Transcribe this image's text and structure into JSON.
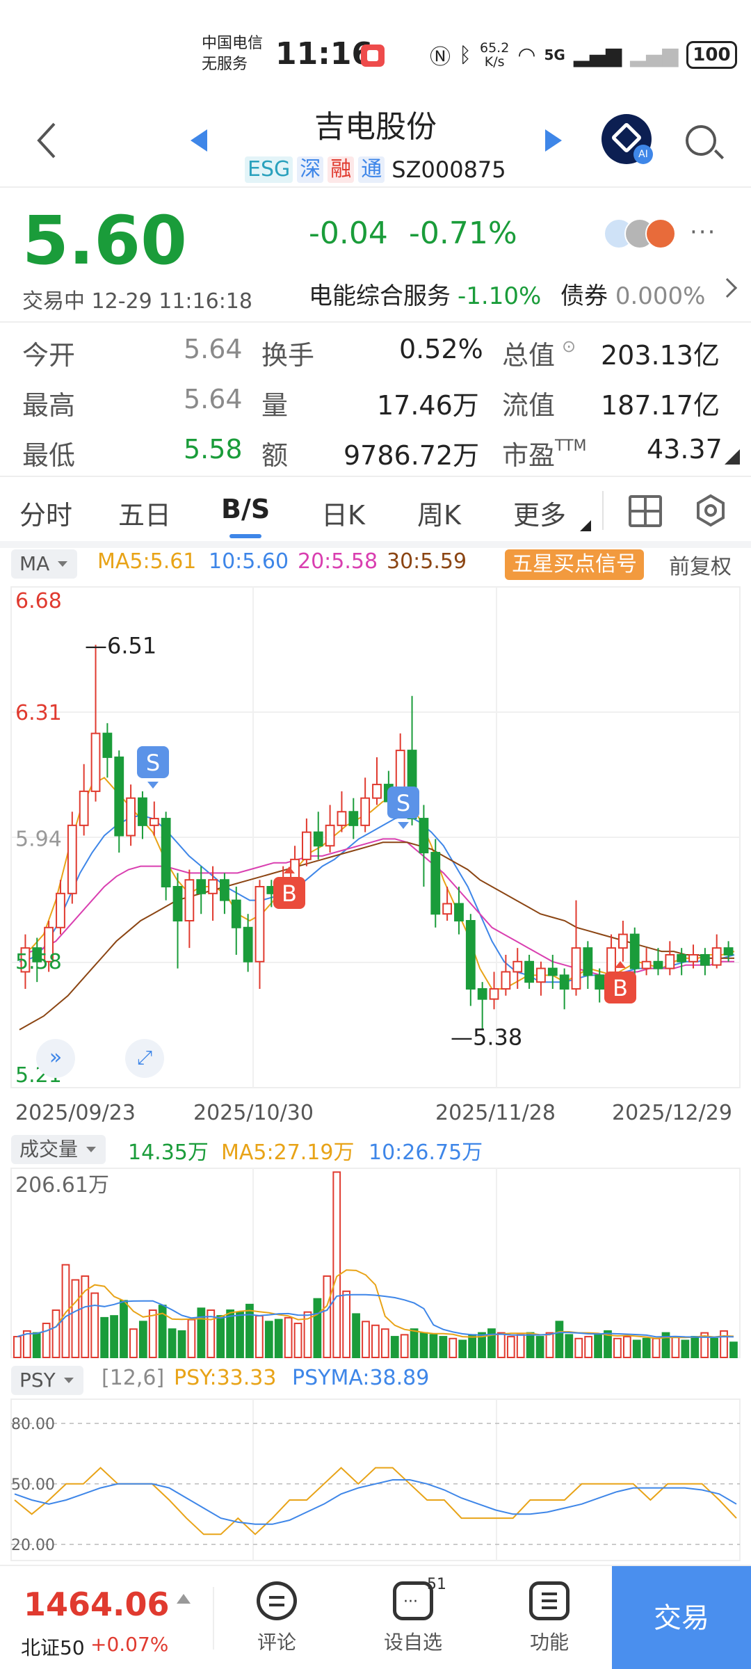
{
  "status_bar": {
    "carrier_line1": "中国电信",
    "carrier_line2": "无服务",
    "time": "11:16",
    "speed_value": "65.2",
    "speed_unit": "K/s",
    "network": "5G",
    "battery": "100"
  },
  "header": {
    "title": "吉电股份",
    "tags": [
      "ESG",
      "深",
      "融",
      "通"
    ],
    "code": "SZ000875",
    "ai_badge": "AI"
  },
  "quote": {
    "price": "5.60",
    "change": "-0.04",
    "change_pct": "-0.71%",
    "trade_time": "交易中 12-29 11:16:18",
    "sector_name": "电能综合服务",
    "sector_change": "-1.10%",
    "bond_label": "债券",
    "bond_value": "0.000%",
    "more": "···"
  },
  "stats": [
    [
      {
        "label": "今开",
        "value": "5.64"
      },
      {
        "label": "换手",
        "value": "0.52%"
      },
      {
        "label": "总值",
        "value": "203.13亿"
      }
    ],
    [
      {
        "label": "最高",
        "value": "5.64"
      },
      {
        "label": "量",
        "value": "17.46万"
      },
      {
        "label": "流值",
        "value": "187.17亿"
      }
    ],
    [
      {
        "label": "最低",
        "value": "5.58"
      },
      {
        "label": "额",
        "value": "9786.72万"
      },
      {
        "label": "市盈",
        "label_sup": "TTM",
        "value": "43.37"
      }
    ]
  ],
  "tabs": [
    "分时",
    "五日",
    "B/S",
    "日K",
    "周K",
    "更多"
  ],
  "active_tab": "B/S",
  "ma_bar": {
    "selector": "MA",
    "ma5": "MA5:5.61",
    "ma10": "10:5.60",
    "ma20": "20:5.58",
    "ma30": "30:5.59",
    "signal": "五星买点信号",
    "adjust": "前复权"
  },
  "colors": {
    "up": "#e03a2f",
    "down": "#1a9c3a",
    "ma5": "#e8a317",
    "ma10": "#3e86e8",
    "ma20": "#d93fb0",
    "ma30": "#8b4513",
    "accent": "#3e86e8"
  },
  "chart_data": [
    {
      "type": "candlestick",
      "price_axis_labels": [
        "6.68",
        "6.31",
        "5.94",
        "5.58",
        "5.21"
      ],
      "ylim": [
        5.21,
        6.68
      ],
      "x_tick_labels": [
        "2025/09/23",
        "2025/10/30",
        "2025/11/28",
        "2025/12/29"
      ],
      "annotations": {
        "high": "6.51",
        "low": "5.38",
        "sell_marker": "S",
        "buy_marker": "B"
      },
      "candles": [
        {
          "o": 5.55,
          "c": 5.62,
          "h": 5.66,
          "l": 5.5
        },
        {
          "o": 5.62,
          "c": 5.58,
          "h": 5.65,
          "l": 5.52
        },
        {
          "o": 5.58,
          "c": 5.68,
          "h": 5.7,
          "l": 5.55
        },
        {
          "o": 5.68,
          "c": 5.78,
          "h": 5.82,
          "l": 5.66
        },
        {
          "o": 5.78,
          "c": 5.98,
          "h": 6.02,
          "l": 5.75
        },
        {
          "o": 5.98,
          "c": 6.08,
          "h": 6.16,
          "l": 5.95
        },
        {
          "o": 6.08,
          "c": 6.25,
          "h": 6.51,
          "l": 6.05
        },
        {
          "o": 6.25,
          "c": 6.18,
          "h": 6.28,
          "l": 6.12
        },
        {
          "o": 6.18,
          "c": 5.95,
          "h": 6.2,
          "l": 5.9
        },
        {
          "o": 5.95,
          "c": 6.06,
          "h": 6.1,
          "l": 5.92
        },
        {
          "o": 6.06,
          "c": 5.98,
          "h": 6.08,
          "l": 5.94
        },
        {
          "o": 5.98,
          "c": 6.0,
          "h": 6.05,
          "l": 5.95
        },
        {
          "o": 6.0,
          "c": 5.8,
          "h": 6.02,
          "l": 5.76
        },
        {
          "o": 5.8,
          "c": 5.7,
          "h": 5.84,
          "l": 5.56
        },
        {
          "o": 5.7,
          "c": 5.82,
          "h": 5.85,
          "l": 5.62
        },
        {
          "o": 5.82,
          "c": 5.78,
          "h": 5.86,
          "l": 5.72
        },
        {
          "o": 5.78,
          "c": 5.82,
          "h": 5.86,
          "l": 5.7
        },
        {
          "o": 5.82,
          "c": 5.76,
          "h": 5.84,
          "l": 5.72
        },
        {
          "o": 5.76,
          "c": 5.68,
          "h": 5.8,
          "l": 5.6
        },
        {
          "o": 5.68,
          "c": 5.58,
          "h": 5.72,
          "l": 5.55
        },
        {
          "o": 5.58,
          "c": 5.8,
          "h": 5.82,
          "l": 5.5
        },
        {
          "o": 5.8,
          "c": 5.78,
          "h": 5.82,
          "l": 5.74
        },
        {
          "o": 5.78,
          "c": 5.82,
          "h": 5.86,
          "l": 5.76
        },
        {
          "o": 5.82,
          "c": 5.88,
          "h": 5.92,
          "l": 5.8
        },
        {
          "o": 5.88,
          "c": 5.96,
          "h": 6.0,
          "l": 5.86
        },
        {
          "o": 5.96,
          "c": 5.92,
          "h": 6.02,
          "l": 5.88
        },
        {
          "o": 5.92,
          "c": 5.98,
          "h": 6.04,
          "l": 5.9
        },
        {
          "o": 5.98,
          "c": 6.02,
          "h": 6.08,
          "l": 5.96
        },
        {
          "o": 6.02,
          "c": 5.98,
          "h": 6.06,
          "l": 5.94
        },
        {
          "o": 5.98,
          "c": 6.06,
          "h": 6.12,
          "l": 5.96
        },
        {
          "o": 6.06,
          "c": 6.1,
          "h": 6.18,
          "l": 6.04
        },
        {
          "o": 6.1,
          "c": 6.05,
          "h": 6.14,
          "l": 6.02
        },
        {
          "o": 6.05,
          "c": 6.2,
          "h": 6.25,
          "l": 6.0
        },
        {
          "o": 6.2,
          "c": 6.0,
          "h": 6.36,
          "l": 5.98
        },
        {
          "o": 6.0,
          "c": 5.9,
          "h": 6.04,
          "l": 5.8
        },
        {
          "o": 5.9,
          "c": 5.72,
          "h": 5.94,
          "l": 5.68
        },
        {
          "o": 5.72,
          "c": 5.75,
          "h": 5.8,
          "l": 5.7
        },
        {
          "o": 5.75,
          "c": 5.7,
          "h": 5.8,
          "l": 5.66
        },
        {
          "o": 5.7,
          "c": 5.5,
          "h": 5.72,
          "l": 5.45
        },
        {
          "o": 5.5,
          "c": 5.47,
          "h": 5.52,
          "l": 5.38
        },
        {
          "o": 5.47,
          "c": 5.5,
          "h": 5.55,
          "l": 5.44
        },
        {
          "o": 5.5,
          "c": 5.55,
          "h": 5.6,
          "l": 5.48
        },
        {
          "o": 5.55,
          "c": 5.58,
          "h": 5.62,
          "l": 5.5
        },
        {
          "o": 5.58,
          "c": 5.52,
          "h": 5.6,
          "l": 5.5
        },
        {
          "o": 5.52,
          "c": 5.56,
          "h": 5.58,
          "l": 5.48
        },
        {
          "o": 5.56,
          "c": 5.54,
          "h": 5.6,
          "l": 5.5
        },
        {
          "o": 5.54,
          "c": 5.5,
          "h": 5.56,
          "l": 5.44
        },
        {
          "o": 5.5,
          "c": 5.62,
          "h": 5.76,
          "l": 5.48
        },
        {
          "o": 5.62,
          "c": 5.54,
          "h": 5.64,
          "l": 5.5
        },
        {
          "o": 5.54,
          "c": 5.5,
          "h": 5.56,
          "l": 5.46
        },
        {
          "o": 5.5,
          "c": 5.62,
          "h": 5.66,
          "l": 5.48
        },
        {
          "o": 5.62,
          "c": 5.66,
          "h": 5.7,
          "l": 5.58
        },
        {
          "o": 5.66,
          "c": 5.56,
          "h": 5.68,
          "l": 5.52
        },
        {
          "o": 5.56,
          "c": 5.58,
          "h": 5.62,
          "l": 5.54
        },
        {
          "o": 5.58,
          "c": 5.56,
          "h": 5.62,
          "l": 5.54
        },
        {
          "o": 5.56,
          "c": 5.6,
          "h": 5.64,
          "l": 5.54
        },
        {
          "o": 5.6,
          "c": 5.58,
          "h": 5.62,
          "l": 5.54
        },
        {
          "o": 5.58,
          "c": 5.6,
          "h": 5.63,
          "l": 5.56
        },
        {
          "o": 5.6,
          "c": 5.57,
          "h": 5.62,
          "l": 5.54
        },
        {
          "o": 5.57,
          "c": 5.62,
          "h": 5.66,
          "l": 5.56
        },
        {
          "o": 5.62,
          "c": 5.6,
          "h": 5.64,
          "l": 5.58
        }
      ],
      "ma_lines": {
        "ma5": [
          5.6,
          5.62,
          5.66,
          5.76,
          5.9,
          6.02,
          6.1,
          6.12,
          6.08,
          6.04,
          6.0,
          5.96,
          5.88,
          5.82,
          5.78,
          5.8,
          5.8,
          5.78,
          5.72,
          5.7,
          5.72,
          5.76,
          5.8,
          5.86,
          5.9,
          5.92,
          5.95,
          5.98,
          6.0,
          6.02,
          6.05,
          6.06,
          6.06,
          6.0,
          5.92,
          5.82,
          5.74,
          5.66,
          5.56,
          5.5,
          5.5,
          5.52,
          5.54,
          5.54,
          5.54,
          5.52,
          5.54,
          5.56,
          5.55,
          5.54,
          5.56,
          5.58,
          5.57,
          5.56,
          5.58,
          5.59,
          5.59,
          5.6,
          5.6,
          5.61
        ],
        "ma10": [
          5.58,
          5.59,
          5.62,
          5.68,
          5.76,
          5.84,
          5.9,
          5.95,
          5.98,
          6.0,
          6.01,
          6.0,
          5.97,
          5.93,
          5.89,
          5.86,
          5.83,
          5.8,
          5.78,
          5.76,
          5.76,
          5.77,
          5.78,
          5.8,
          5.83,
          5.86,
          5.88,
          5.91,
          5.94,
          5.96,
          5.98,
          6.0,
          6.01,
          5.99,
          5.96,
          5.92,
          5.86,
          5.8,
          5.72,
          5.64,
          5.58,
          5.55,
          5.54,
          5.52,
          5.52,
          5.52,
          5.53,
          5.54,
          5.54,
          5.54,
          5.55,
          5.56,
          5.56,
          5.56,
          5.57,
          5.58,
          5.58,
          5.59,
          5.59,
          5.6
        ],
        "ma20": [
          5.6,
          5.61,
          5.62,
          5.64,
          5.68,
          5.72,
          5.76,
          5.8,
          5.83,
          5.85,
          5.86,
          5.86,
          5.86,
          5.85,
          5.84,
          5.84,
          5.84,
          5.84,
          5.84,
          5.85,
          5.86,
          5.87,
          5.87,
          5.88,
          5.89,
          5.89,
          5.9,
          5.91,
          5.92,
          5.93,
          5.94,
          5.94,
          5.93,
          5.9,
          5.87,
          5.84,
          5.8,
          5.76,
          5.72,
          5.68,
          5.66,
          5.64,
          5.62,
          5.6,
          5.58,
          5.57,
          5.56,
          5.55,
          5.54,
          5.54,
          5.55,
          5.55,
          5.56,
          5.56,
          5.56,
          5.57,
          5.57,
          5.57,
          5.58,
          5.58
        ],
        "ma30": [
          5.38,
          5.4,
          5.42,
          5.45,
          5.48,
          5.52,
          5.56,
          5.6,
          5.64,
          5.67,
          5.7,
          5.72,
          5.74,
          5.76,
          5.77,
          5.78,
          5.79,
          5.8,
          5.81,
          5.82,
          5.83,
          5.84,
          5.85,
          5.86,
          5.87,
          5.88,
          5.89,
          5.9,
          5.91,
          5.92,
          5.93,
          5.93,
          5.93,
          5.92,
          5.91,
          5.89,
          5.87,
          5.85,
          5.82,
          5.8,
          5.78,
          5.76,
          5.74,
          5.72,
          5.71,
          5.7,
          5.68,
          5.67,
          5.66,
          5.65,
          5.64,
          5.63,
          5.62,
          5.61,
          5.61,
          5.6,
          5.6,
          5.59,
          5.59,
          5.59
        ]
      }
    },
    {
      "type": "bar",
      "y_axis_label": "206.61万",
      "volumes": [
        22,
        28,
        26,
        36,
        50,
        98,
        82,
        86,
        68,
        42,
        44,
        60,
        30,
        38,
        50,
        55,
        30,
        28,
        40,
        52,
        50,
        44,
        50,
        48,
        56,
        44,
        38,
        40,
        42,
        36,
        48,
        62,
        86,
        196,
        70,
        46,
        38,
        34,
        30,
        22,
        24,
        30,
        26,
        24,
        22,
        20,
        18,
        24,
        26,
        30,
        26,
        22,
        24,
        26,
        22,
        26,
        38,
        24,
        20,
        22,
        24,
        28,
        20,
        22,
        18,
        20,
        20,
        26,
        22,
        18,
        22,
        26,
        20,
        28,
        16
      ]
    },
    {
      "type": "line",
      "y_tick_labels": [
        "80.00",
        "50.00",
        "20.00"
      ],
      "ylim": [
        20,
        80
      ],
      "series": [
        {
          "name": "PSY",
          "values": [
            42,
            35,
            42,
            50,
            50,
            58,
            50,
            50,
            50,
            42,
            33,
            25,
            25,
            33,
            25,
            33,
            42,
            42,
            50,
            58,
            50,
            58,
            58,
            50,
            42,
            42,
            33,
            33,
            33,
            33,
            42,
            42,
            42,
            50,
            50,
            50,
            50,
            42,
            50,
            50,
            50,
            42,
            33
          ]
        },
        {
          "name": "PSYMA",
          "values": [
            45,
            42,
            40,
            42,
            45,
            48,
            50,
            50,
            50,
            48,
            43,
            38,
            33,
            31,
            30,
            30,
            32,
            36,
            40,
            45,
            48,
            50,
            52,
            52,
            50,
            47,
            43,
            40,
            37,
            35,
            35,
            36,
            38,
            40,
            43,
            46,
            48,
            48,
            48,
            48,
            47,
            45,
            40
          ]
        }
      ]
    }
  ],
  "volume_bar": {
    "selector": "成交量",
    "vol": "14.35万",
    "ma5": "MA5:27.19万",
    "ma10": "10:26.75万"
  },
  "psy_bar": {
    "selector": "PSY",
    "params": "[12,6]",
    "psy": "PSY:33.33",
    "psyma": "PSYMA:38.89"
  },
  "bottom_bar": {
    "index_value": "1464.06",
    "index_name": "北证50",
    "index_change": "+0.07%",
    "comment": "评论",
    "watchlist": "设自选",
    "watchlist_badge": "51",
    "functions": "功能",
    "trade": "交易"
  }
}
